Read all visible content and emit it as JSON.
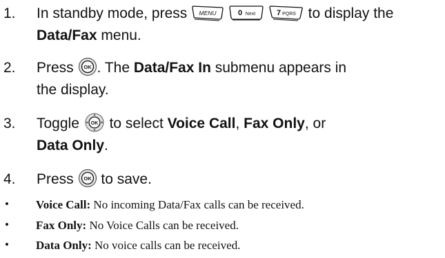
{
  "steps": [
    {
      "number": "1.",
      "text_a": "In standby mode, press",
      "keys": [
        {
          "label": "MENU",
          "icon": "menu-key-icon"
        },
        {
          "label": "0",
          "sub": "Next",
          "icon": "zero-next-key-icon"
        },
        {
          "label": "7",
          "sub": "PQRS",
          "icon": "seven-pqrs-key-icon"
        }
      ],
      "text_b": "to display the",
      "bold_a": "Data/Fax",
      "text_c": "menu."
    },
    {
      "number": "2.",
      "text_a": "Press",
      "button": {
        "label": "OK",
        "icon": "ok-button-icon"
      },
      "text_b": ". The",
      "bold_a": "Data/Fax In",
      "text_c": "submenu appears in",
      "text_d": "the display."
    },
    {
      "number": "3.",
      "text_a": "Toggle",
      "button": {
        "label": "OK",
        "icon": "navigation-key-icon"
      },
      "text_b": "to select",
      "bold_a": "Voice Call",
      "text_c": ",",
      "bold_b": "Fax Only",
      "text_d": ", or",
      "bold_c": "Data Only",
      "text_e": "."
    },
    {
      "number": "4.",
      "text_a": "Press",
      "button": {
        "label": "OK",
        "icon": "ok-button-icon"
      },
      "text_b": "to save."
    }
  ],
  "bullets": [
    {
      "bullet": "•",
      "term": "Voice Call:",
      "desc": "No incoming Data/Fax calls can be received."
    },
    {
      "bullet": "•",
      "term": "Fax Only:",
      "desc": "No Voice Calls can be received."
    },
    {
      "bullet": "•",
      "term": "Data Only:",
      "desc": "No voice calls can be received."
    }
  ]
}
